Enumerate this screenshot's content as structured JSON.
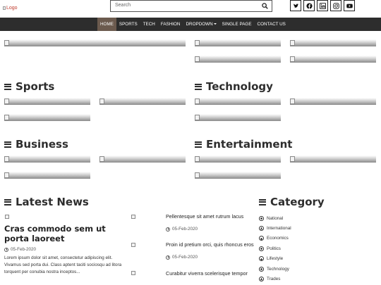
{
  "header": {
    "logo_alt": "Logo",
    "search_placeholder": "Search",
    "social_icons": [
      "twitter-icon",
      "facebook-icon",
      "linkedin-icon",
      "instagram-icon",
      "youtube-icon"
    ]
  },
  "nav": {
    "items": [
      "HOME",
      "SPORTS",
      "TECH",
      "FASHION",
      "DROPDOWN",
      "SINGLE PAGE",
      "CONTACT US"
    ],
    "active_index": 0,
    "active_color": "#6b5a4e",
    "bar_color": "#2d2d2d"
  },
  "sections": {
    "sports": "Sports",
    "technology": "Technology",
    "business": "Business",
    "entertainment": "Entertainment",
    "latest_news": "Latest News",
    "category": "Category"
  },
  "latest": {
    "featured": {
      "title": "Cras commodo sem ut porta laoreet",
      "date": "05-Feb-2020",
      "excerpt": "Lorem ipsum dolor sit amet, consectetur adipiscing elit. Vivamus sed porta dui. Class aptent taciti sociosqu ad litora torquent per conubia nostra inceptos..."
    },
    "side": [
      {
        "title": "Pellentesque sit amet rutrum lacus",
        "date": "05-Feb-2020"
      },
      {
        "title": "Proin id pretium orci, quis rhoncus eros",
        "date": "05-Feb-2020"
      },
      {
        "title": "Curabitur viverra scelerisque tempor",
        "date": ""
      }
    ]
  },
  "categories": [
    "National",
    "International",
    "Economics",
    "Politics",
    "Lifestyle",
    "Technology",
    "Trades"
  ]
}
